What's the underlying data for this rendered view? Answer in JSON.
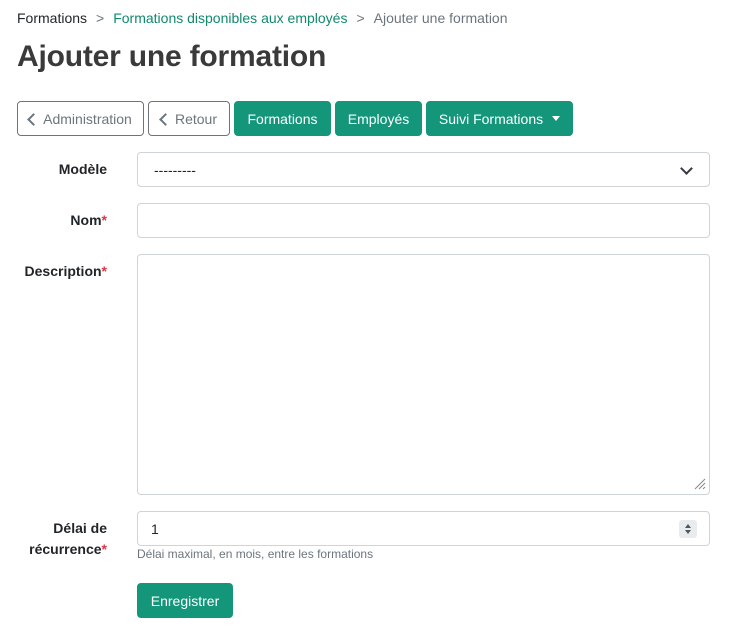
{
  "breadcrumb": {
    "items": [
      "Formations",
      "Formations disponibles aux employés",
      "Ajouter une formation"
    ],
    "separator": ">"
  },
  "page": {
    "title": "Ajouter une formation"
  },
  "toolbar": {
    "administration": "Administration",
    "retour": "Retour",
    "formations": "Formations",
    "employes": "Employés",
    "suivi": "Suivi Formations"
  },
  "form": {
    "modele": {
      "label": "Modèle",
      "value": "---------"
    },
    "nom": {
      "label": "Nom",
      "required_mark": "*",
      "value": ""
    },
    "description": {
      "label": "Description",
      "required_mark": "*",
      "value": ""
    },
    "delai": {
      "label_line1": "Délai de",
      "label_line2": "récurrence",
      "required_mark": "*",
      "value": "1",
      "help": "Délai maximal, en mois, entre les formations"
    },
    "submit": "Enregistrer"
  },
  "colors": {
    "accent": "#13967a",
    "link": "#0f8a6e",
    "required": "#dc3545",
    "muted": "#6c757d"
  }
}
